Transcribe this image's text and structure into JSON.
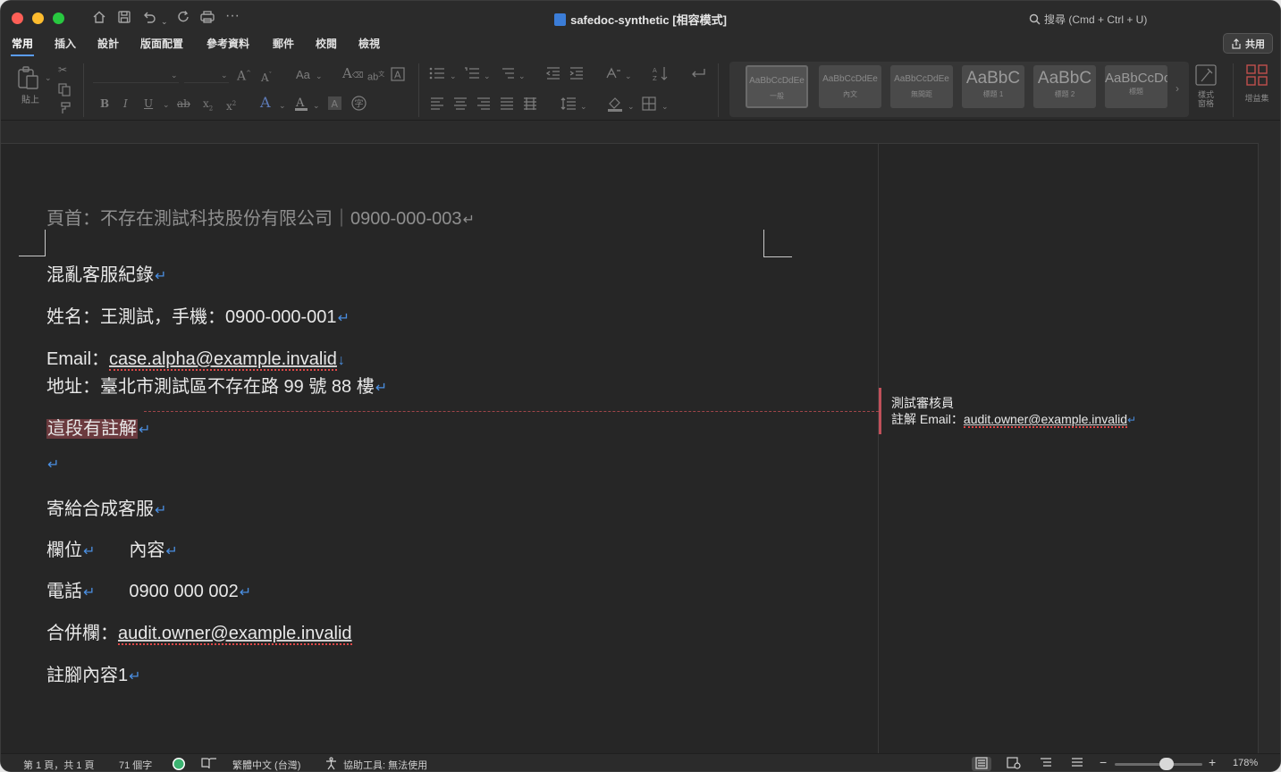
{
  "window": {
    "title": "safedoc-synthetic [相容模式]",
    "search_label": "搜尋 (Cmd + Ctrl + U)",
    "share_label": "共用"
  },
  "ribbon": {
    "tabs": [
      "常用",
      "插入",
      "設計",
      "版面配置",
      "參考資料",
      "郵件",
      "校閱",
      "檢視"
    ],
    "active_tab": "常用",
    "paste_label": "貼上",
    "styles": [
      {
        "preview": "AaBbCcDdEe",
        "label": "一般",
        "selected": true
      },
      {
        "preview": "AaBbCcDdEe",
        "label": "內文"
      },
      {
        "preview": "AaBbCcDdEe",
        "label": "無間距"
      },
      {
        "preview": "AaBbC",
        "label": "標題 1"
      },
      {
        "preview": "AaBbC",
        "label": "標題 2"
      },
      {
        "preview": "AaBbCcDc",
        "label": "標題"
      }
    ],
    "styles_pane_label": "樣式\n窗格",
    "addins_label": "增益集"
  },
  "document": {
    "header": "頁首：不存在測試科技股份有限公司｜0900-000-003",
    "lines": {
      "title": "混亂客服紀錄",
      "name": "姓名：王測試，手機：0900-000-001",
      "email_label": "Email：",
      "email_value": "case.alpha@example.invalid",
      "address": "地址：臺北市測試區不存在路 99 號 88 樓",
      "commented": "這段有註解",
      "sendto": "寄給合成客服",
      "field_label": "欄位",
      "field_content": "內容",
      "phone_label": "電話",
      "phone_value": "0900 000 002",
      "merged_label": "合併欄：",
      "merged_value": "audit.owner@example.invalid",
      "footnote": "註腳內容1"
    },
    "paragraph_mark": "↵",
    "line_break_mark": "↓",
    "comment": {
      "author": "測試審核員",
      "text_label": "註解 Email：",
      "text_value": "audit.owner@example.invalid"
    }
  },
  "statusbar": {
    "page": "第 1 頁，共 1 頁",
    "words": "71 個字",
    "language": "繁體中文 (台灣)",
    "accessibility": "協助工具: 無法使用",
    "zoom": "178%",
    "zoom_level_percent": 178
  },
  "colors": {
    "accent": "#5a9cf8",
    "comment": "#c0505a",
    "paragraph_mark": "#4a8ee0"
  }
}
